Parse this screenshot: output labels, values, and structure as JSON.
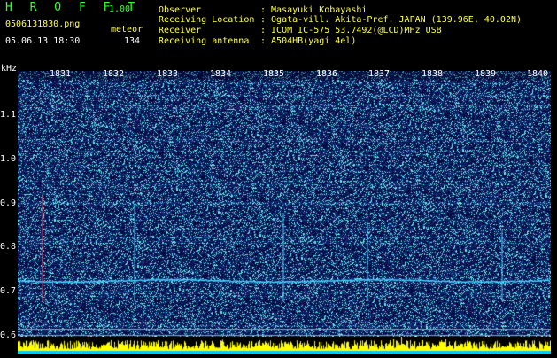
{
  "app": {
    "title": "H R O F F T",
    "version": "1.00",
    "filename": "0506131830.png",
    "datetime": "05.06.13 18:30",
    "event_label": "meteor",
    "event_count": "134"
  },
  "info": {
    "rows": [
      {
        "key": "Observer",
        "value": ": Masayuki Kobayashi"
      },
      {
        "key": "Receiving Location",
        "value": ": Ogata-vill. Akita-Pref. JAPAN (139.96E, 40.02N)"
      },
      {
        "key": "Receiver",
        "value": ": ICOM IC-575 53.7492(@LCD)MHz USB"
      },
      {
        "key": "Receiving antenna",
        "value": ": A504HB(yagi 4el)"
      }
    ]
  },
  "spectrogram": {
    "y_unit": "kHz",
    "y_ticks": [
      "1.1",
      "1.0",
      "0.9",
      "0.8",
      "0.7",
      "0.6"
    ],
    "x_ticks": [
      "1831",
      "1832",
      "1833",
      "1834",
      "1835",
      "1836",
      "1837",
      "1838",
      "1839",
      "1840"
    ],
    "colors": {
      "background": "#06083d",
      "signal": "#3fd0ff",
      "amplitude": "#ffff00",
      "amplitude_base": "#00c8ff"
    }
  }
}
